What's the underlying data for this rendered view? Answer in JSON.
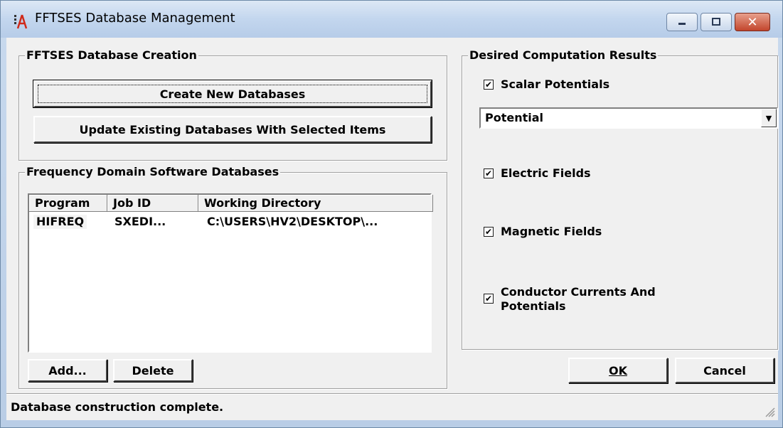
{
  "window": {
    "title": "FFTSES Database Management",
    "controls": {
      "minimize": "—",
      "maximize": "☐",
      "close": "✕"
    }
  },
  "creation_group": {
    "title": "FFTSES Database Creation",
    "create_button": "Create New Databases",
    "update_button": "Update Existing Databases With Selected Items"
  },
  "databases_group": {
    "title": "Frequency Domain Software Databases",
    "columns": [
      "Program",
      "Job ID",
      "Working Directory"
    ],
    "rows": [
      {
        "program": "HIFREQ",
        "job_id": "SXEDI...",
        "directory": "C:\\USERS\\HV2\\DESKTOP\\..."
      }
    ],
    "add_button": "Add...",
    "delete_button": "Delete"
  },
  "results_group": {
    "title": "Desired Computation Results",
    "scalar_potentials": {
      "label": "Scalar Potentials",
      "checked": true
    },
    "potential_select": {
      "value": "Potential"
    },
    "electric_fields": {
      "label": "Electric Fields",
      "checked": true
    },
    "magnetic_fields": {
      "label": "Magnetic Fields",
      "checked": true
    },
    "conductor_currents": {
      "label_line1": "Conductor Currents And",
      "label_line2": "Potentials",
      "checked": true
    }
  },
  "dialog_buttons": {
    "ok": "OK",
    "cancel": "Cancel"
  },
  "status": {
    "text": "Database construction complete."
  },
  "icons": [
    "app-icon",
    "minimize-icon",
    "maximize-icon",
    "close-icon",
    "dropdown-arrow-icon",
    "resize-grip-icon"
  ]
}
